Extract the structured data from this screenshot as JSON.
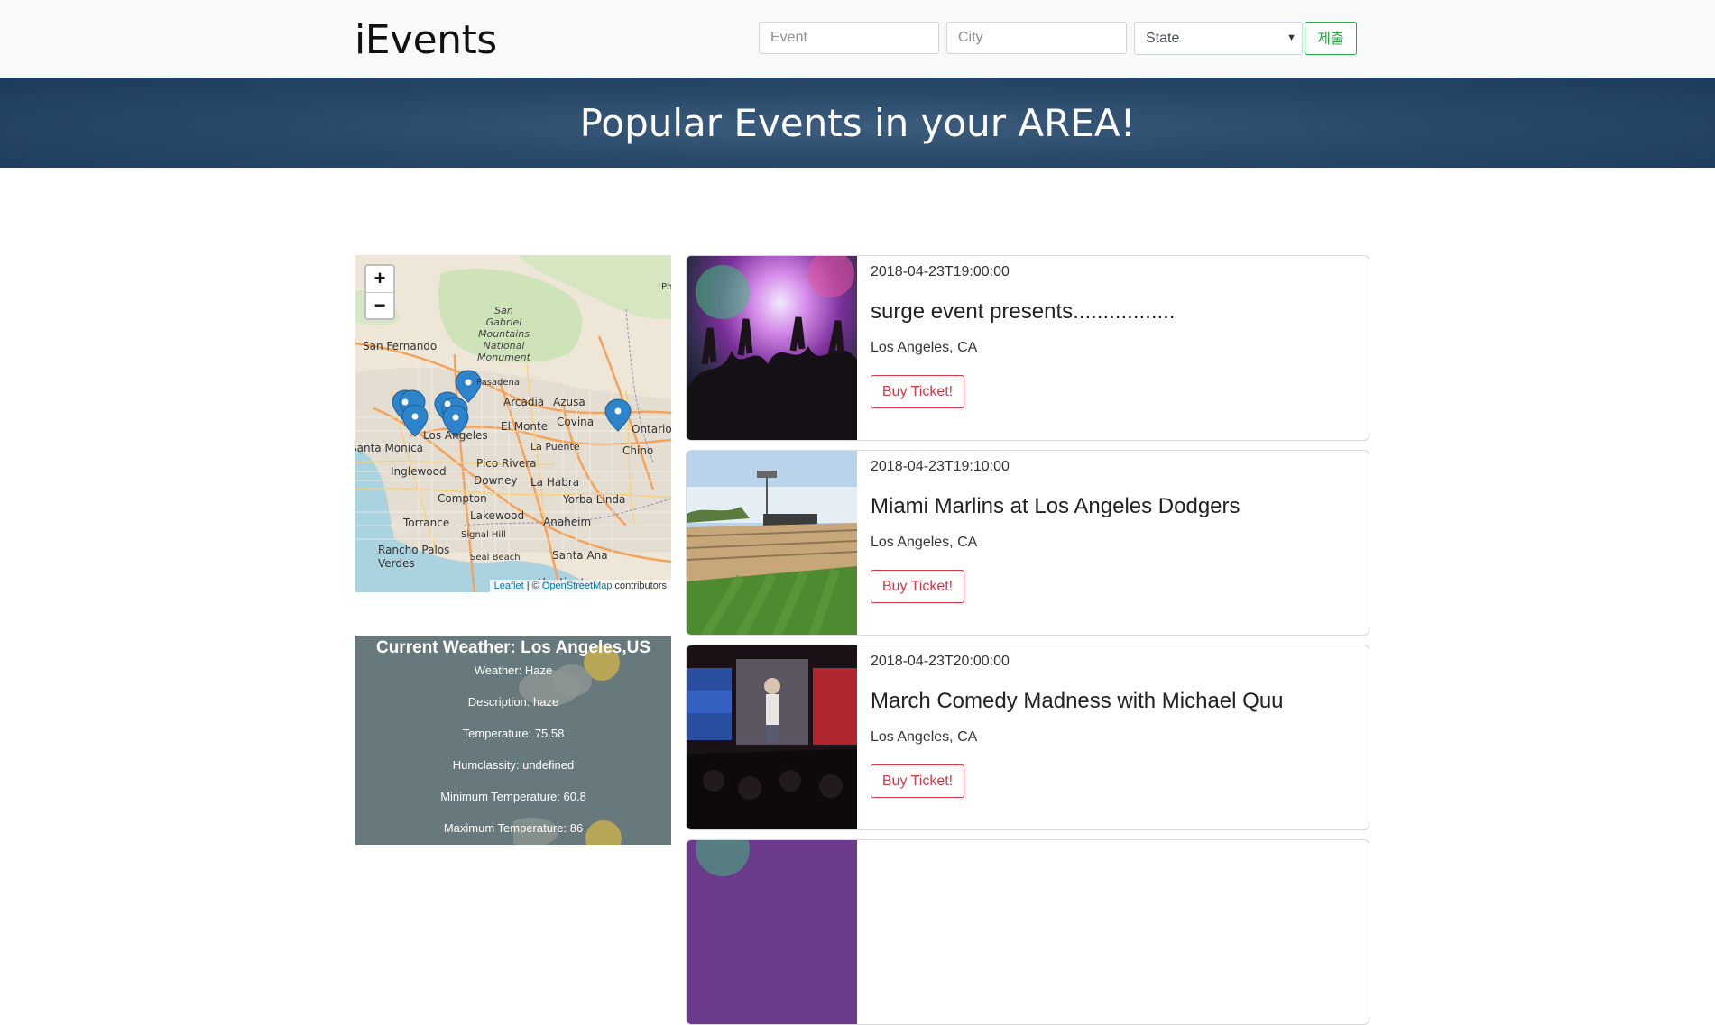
{
  "navbar": {
    "brand": "iEvents",
    "event_placeholder": "Event",
    "city_placeholder": "City",
    "state_selected": "State",
    "submit_label": "제출"
  },
  "hero": {
    "title": "Popular Events in your AREA!"
  },
  "map": {
    "zoom_in": "+",
    "zoom_out": "−",
    "attribution": {
      "leaflet": "Leaflet",
      "separator": " | © ",
      "osm": "OpenStreetMap",
      "suffix": " contributors"
    },
    "city_labels": [
      "San Fernando",
      "Pasadena",
      "Arcadia",
      "Azusa",
      "El Monte",
      "Covina",
      "Los Angeles",
      "Ontario",
      "Santa Monica",
      "La Puente",
      "Chino",
      "Inglewood",
      "Pico Rivera",
      "Downey",
      "La Habra",
      "Compton",
      "Yorba Linda",
      "Lakewood",
      "Anaheim",
      "Torrance",
      "Signal Hill",
      "Rancho Palos Verdes",
      "Seal Beach",
      "Santa Ana",
      "Huntington",
      "Ph"
    ],
    "park_label": "San Gabriel Mountains National Monument"
  },
  "weather": {
    "title": "Current Weather: Los Angeles,US",
    "lines": [
      "Weather: Haze",
      "Description: haze",
      "Temperature: 75.58",
      "Humclassity: undefined",
      "Minimum Temperature: 60.8",
      "Maximum Temperature: 86"
    ]
  },
  "events": [
    {
      "date": "2018-04-23T19:00:00",
      "title": "surge event presents.................",
      "location": "Los Angeles, CA",
      "button": "Buy Ticket!",
      "image": "concert-crowd"
    },
    {
      "date": "2018-04-23T19:10:00",
      "title": "Miami Marlins at Los Angeles Dodgers",
      "location": "Los Angeles, CA",
      "button": "Buy Ticket!",
      "image": "baseball-stadium"
    },
    {
      "date": "2018-04-23T20:00:00",
      "title": "March Comedy Madness with Michael Quu",
      "location": "Los Angeles, CA",
      "button": "Buy Ticket!",
      "image": "comedy-stage"
    }
  ],
  "colors": {
    "hero": "#2a4a6c",
    "submit": "#28a745",
    "buy": "#dc3545",
    "marker": "#2e84cb",
    "weather_bg": "#68797e"
  }
}
